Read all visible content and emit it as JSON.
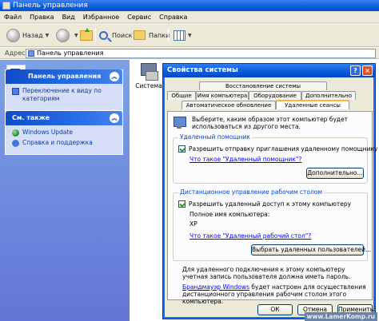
{
  "window": {
    "title": "Панель управления"
  },
  "menu": [
    "Файл",
    "Правка",
    "Вид",
    "Избранное",
    "Сервис",
    "Справка"
  ],
  "toolbar": {
    "back": "Назад",
    "search": "Поиск",
    "folders": "Папки"
  },
  "address": {
    "label": "Адрес:",
    "value": "Панель управления"
  },
  "taskpane": {
    "cp_panel_title": "Панель управления",
    "switch_link": "Переключение к виду по категориям",
    "see_also_title": "См. также",
    "see_also_items": [
      "Windows Update",
      "Справка и поддержка"
    ]
  },
  "content": {
    "system_item": "Система"
  },
  "dialog": {
    "title": "Свойства системы",
    "tabs_row1": [
      "Восстановление системы"
    ],
    "tabs_row2": [
      "Общие",
      "Имя компьютера",
      "Оборудование",
      "Дополнительно"
    ],
    "tabs_row3": [
      "Автоматическое обновление",
      "Удаленные сеансы"
    ],
    "intro": "Выберите, каким образом этот компьютер будет использоваться из другого места.",
    "assistance": {
      "legend": "Удаленный помощник",
      "checkbox": "Разрешить отправку приглашения удаленному помощнику",
      "link": "Что такое \"Удаленный помощник\"?",
      "button": "Дополнительно..."
    },
    "desktop": {
      "legend": "Дистанционное управление рабочим столом",
      "checkbox": "Разрешить удаленный доступ к этому компьютеру",
      "fullname_label": "Полное имя компьютера:",
      "fullname_value": "XP",
      "link": "Что такое \"Удаленный рабочий стол\"?",
      "button": "Выбрать удаленных пользователей...",
      "note": "Для удаленного подключения к этому компьютеру учетная запись пользователя должна иметь пароль.",
      "firewall_link": "Брандмауэр Windows",
      "firewall_rest": " будет настроен для осуществления дистанционного управления рабочим столом этого компьютера."
    },
    "buttons": {
      "ok": "ОК",
      "cancel": "Отмена",
      "apply": "Применить"
    }
  },
  "watermark": "www.LamerKomp.ru"
}
